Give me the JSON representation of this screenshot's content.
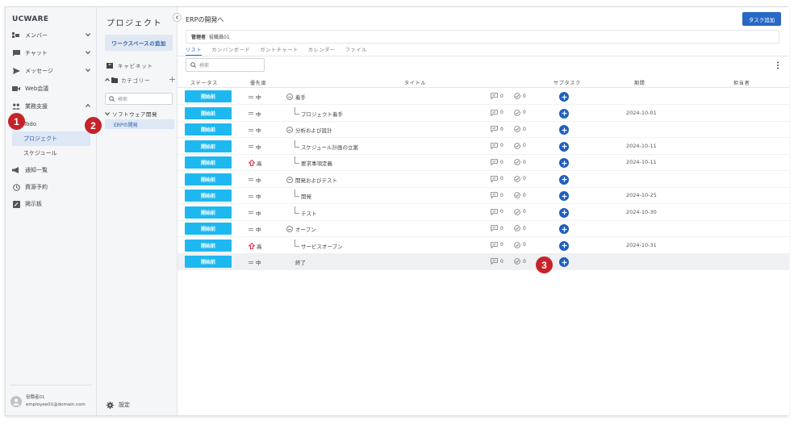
{
  "app": {
    "brand": "UCWARE"
  },
  "nav": {
    "items": [
      {
        "label": "メンバー",
        "icon": "members-icon",
        "chevron": "down"
      },
      {
        "label": "チャット",
        "icon": "chat-icon",
        "chevron": "down"
      },
      {
        "label": "メッセージ",
        "icon": "send-icon",
        "chevron": "down"
      },
      {
        "label": "Web会議",
        "icon": "video-icon",
        "chevron": ""
      },
      {
        "label": "業務支援",
        "icon": "group-icon",
        "chevron": "up"
      }
    ],
    "sub_items": [
      {
        "label": "Todo"
      },
      {
        "label": "プロジェクト"
      },
      {
        "label": "スケジュール"
      }
    ],
    "lower_items": [
      {
        "label": "通知一覧",
        "icon": "megaphone-icon"
      },
      {
        "label": "資源予約",
        "icon": "clock-icon"
      },
      {
        "label": "掲示板",
        "icon": "board-icon"
      }
    ],
    "user": {
      "name": "役職者01",
      "email": "employee01@domain.com"
    }
  },
  "project_panel": {
    "title": "プロジェクト",
    "add_workspace": "ワークスペースの追加",
    "cabinet": "キャビネット",
    "category": "カテゴリー",
    "search_placeholder": "検索",
    "tree_parent": "ソフトウェア開発",
    "tree_child": "ERPの開発",
    "settings": "設定"
  },
  "main": {
    "title": "ERPの開発へ",
    "add_task": "タスク追加",
    "manager_label": "管理者",
    "manager_value": "役職員01",
    "tabs": [
      "リスト",
      "カンバンボード",
      "ガントチャート",
      "カレンダー",
      "ファイル"
    ],
    "search_placeholder": "検索",
    "columns": [
      "ステータス",
      "優先度",
      "タイトル",
      "サブタスク",
      "期間",
      "担当者"
    ],
    "rows": [
      {
        "status": "開始前",
        "priority": "中",
        "title": "着手",
        "level": 1,
        "collapsible": true,
        "comments": "0",
        "checks": "0",
        "due": ""
      },
      {
        "status": "開始前",
        "priority": "中",
        "title": "プロジェクト着手",
        "level": 2,
        "collapsible": false,
        "comments": "0",
        "checks": "0",
        "due": "2024-10-01"
      },
      {
        "status": "開始前",
        "priority": "中",
        "title": "分析および設計",
        "level": 1,
        "collapsible": true,
        "comments": "0",
        "checks": "0",
        "due": ""
      },
      {
        "status": "開始前",
        "priority": "中",
        "title": "スケジュール計画の立案",
        "level": 2,
        "collapsible": false,
        "comments": "0",
        "checks": "0",
        "due": "2024-10-11"
      },
      {
        "status": "開始前",
        "priority": "高",
        "title": "要求事項定義",
        "level": 2,
        "collapsible": false,
        "comments": "0",
        "checks": "0",
        "due": "2024-10-11"
      },
      {
        "status": "開始前",
        "priority": "中",
        "title": "開発およびテスト",
        "level": 1,
        "collapsible": true,
        "comments": "0",
        "checks": "0",
        "due": ""
      },
      {
        "status": "開始前",
        "priority": "中",
        "title": "開発",
        "level": 2,
        "collapsible": false,
        "comments": "0",
        "checks": "0",
        "due": "2024-10-25"
      },
      {
        "status": "開始前",
        "priority": "中",
        "title": "テスト",
        "level": 2,
        "collapsible": false,
        "comments": "0",
        "checks": "0",
        "due": "2024-10-30"
      },
      {
        "status": "開始前",
        "priority": "中",
        "title": "オープン",
        "level": 1,
        "collapsible": true,
        "comments": "0",
        "checks": "0",
        "due": ""
      },
      {
        "status": "開始前",
        "priority": "高",
        "title": "サービスオープン",
        "level": 2,
        "collapsible": false,
        "comments": "0",
        "checks": "0",
        "due": "2024-10-31"
      },
      {
        "status": "開始前",
        "priority": "中",
        "title": "終了",
        "level": 1,
        "collapsible": false,
        "comments": "0",
        "checks": "0",
        "due": ""
      }
    ]
  },
  "annotations": {
    "badge1": "1",
    "badge2": "2",
    "badge3": "3"
  },
  "colors": {
    "status_bg": "#1eb8f0",
    "accent": "#2769c4",
    "badge": "#c6232a",
    "high_priority": "#e0304a"
  }
}
